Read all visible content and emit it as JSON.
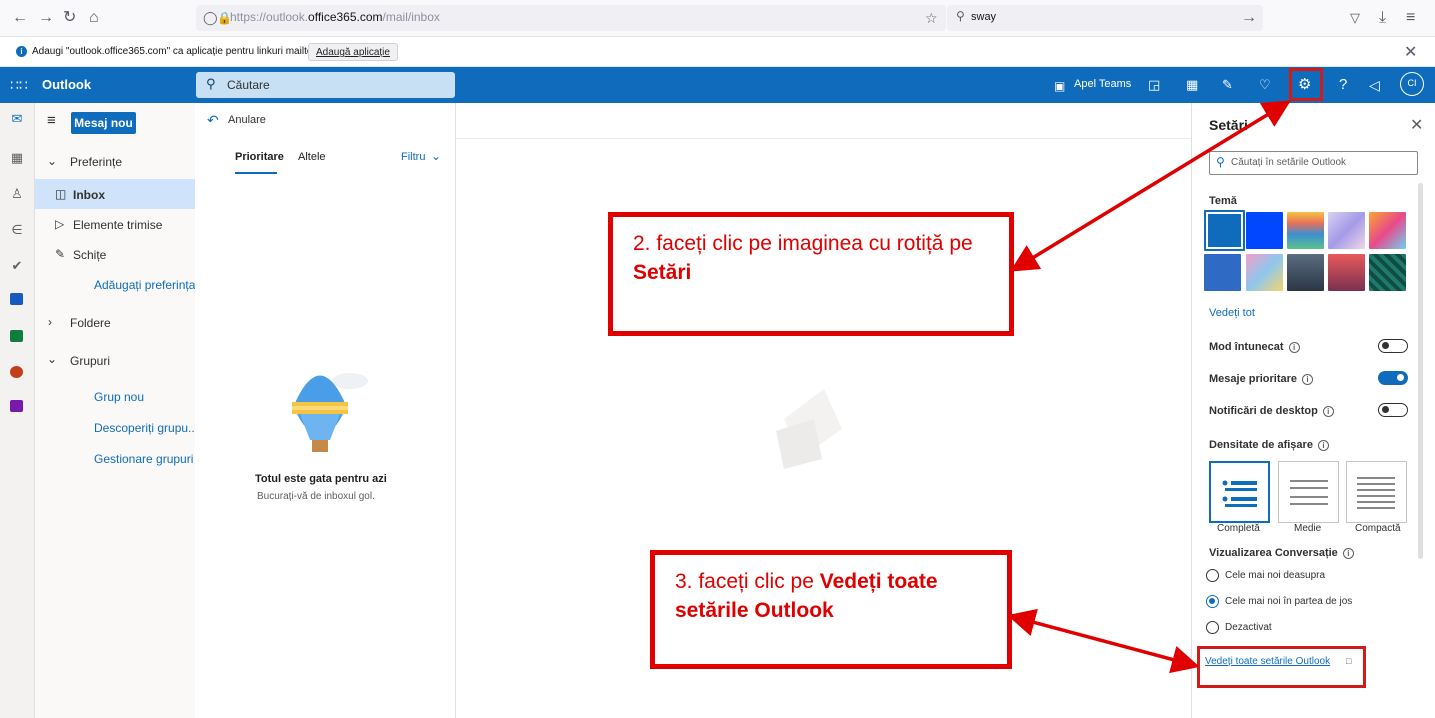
{
  "browser": {
    "url_prefix": "https://outlook.",
    "url_domain": "office365.com",
    "url_path": "/mail/inbox",
    "search_value": "sway"
  },
  "notification": {
    "text": "Adaugi \"outlook.office365.com\" ca aplicație pentru linkuri mailto?",
    "button": "Adaugă aplicație"
  },
  "header": {
    "app_name": "Outlook",
    "search_placeholder": "Căutare",
    "teams_label": "Apel Teams",
    "avatar_initials": "CI"
  },
  "folder_pane": {
    "new_mail": "Mesaj nou",
    "favorites": "Preferințe",
    "inbox": "Inbox",
    "sent": "Elemente trimise",
    "drafts": "Schițe",
    "add_favorite": "Adăugați preferința",
    "folders": "Foldere",
    "groups": "Grupuri",
    "new_group": "Grup nou",
    "discover_groups": "Descoperiți grupu...",
    "manage_groups": "Gestionare grupuri"
  },
  "message_list": {
    "undo": "Anulare",
    "tab_focused": "Prioritare",
    "tab_other": "Altele",
    "filter": "Filtru",
    "empty_title": "Totul este gata pentru azi",
    "empty_sub": "Bucurați-vă de inboxul gol."
  },
  "settings": {
    "title": "Setări",
    "search_placeholder": "Căutați în setările Outlook",
    "theme_label": "Temă",
    "view_all_themes": "Vedeți tot",
    "dark_mode": "Mod întunecat",
    "dark_mode_on": false,
    "focused_inbox": "Mesaje prioritare",
    "focused_inbox_on": true,
    "desktop_notifications": "Notificări de desktop",
    "desktop_notifications_on": false,
    "density_label": "Densitate de afișare",
    "density_full": "Completă",
    "density_medium": "Medie",
    "density_compact": "Compactă",
    "conversation_label": "Vizualizarea Conversație",
    "conv_newest_top": "Cele mai noi deasupra",
    "conv_newest_bottom": "Cele mai noi în partea de jos",
    "conv_off": "Dezactivat",
    "view_all_settings": "Vedeți toate setările Outlook"
  },
  "callouts": {
    "step2_text": "2. faceți clic pe imaginea cu rotiță pe ",
    "step2_bold": "Setări",
    "step3_text": "3. faceți clic pe ",
    "step3_bold": "Vedeți toate setările Outlook"
  },
  "colors": {
    "outlook_blue": "#0f6cbd",
    "annotation_red": "#e00000"
  }
}
